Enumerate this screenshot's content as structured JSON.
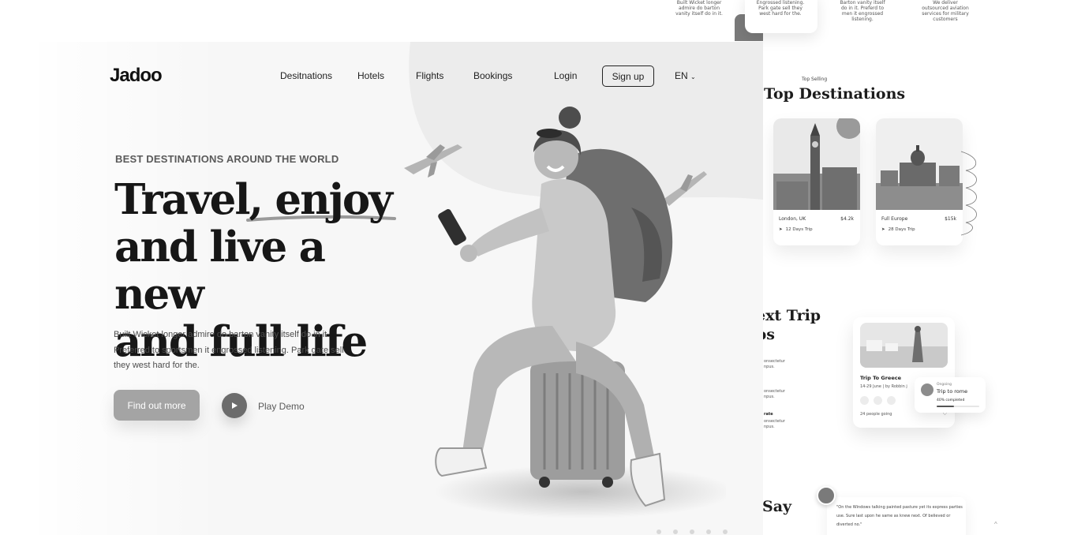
{
  "services": [
    {
      "text": "Built Wicket longer admire do barton vanity itself do in it."
    },
    {
      "text": "Engrossed listening. Park gate sell they west hard for the."
    },
    {
      "text": "Barton vanity itself do in it. Preferd to men it engrossed listening."
    },
    {
      "text": "We deliver outsourced aviation services for military customers"
    }
  ],
  "top_destinations": {
    "subtitle": "Top Selling",
    "title": "Top Destinations",
    "cards": [
      {
        "place": "London, UK",
        "price": "$4.2k",
        "trip": "12 Days Trip"
      },
      {
        "place": "Full Europe",
        "price": "$15k",
        "trip": "28 Days Trip"
      }
    ]
  },
  "next_trip": {
    "title_line1": "ext Trip",
    "title_line2": "ps",
    "lines": [
      "onsectetur",
      "npus.",
      "onsectetur",
      "npus.",
      "rate",
      "onsectetur",
      "npus."
    ],
    "card": {
      "title": "Trip To Greece",
      "meta": "14-29 June  |  by Robbin j",
      "going": "24 people going"
    },
    "ongoing": {
      "label": "Ongoing",
      "title": "Trip to rome",
      "percent_text": "40% completed",
      "progress": 0.4
    }
  },
  "testimonial": {
    "title": "Say",
    "text": "\"On the Windows talking painted pasture yet its express parties use. Sure last upon he same as knew next. Of believed or diverted no.\""
  },
  "hero": {
    "logo": "Jadoo",
    "nav": [
      "Desitnations",
      "Hotels",
      "Flights",
      "Bookings"
    ],
    "login": "Login",
    "signup": "Sign up",
    "language": "EN",
    "eyebrow": "BEST DESTINATIONS AROUND THE WORLD",
    "headline_line1": "Travel, enjoy",
    "headline_line2": "and live a new",
    "headline_line3": "and full life",
    "description": "Built Wicket longer admire do barton vanity itself do in it. Preferred to sportsmen it engrossed listening. Park gate sell they west hard for the.",
    "cta": "Find out more",
    "play": "Play Demo"
  },
  "colors": {
    "hero_bg": "#f7f7f7",
    "cta_bg": "#a4a4a4",
    "text_dark": "#171717"
  }
}
